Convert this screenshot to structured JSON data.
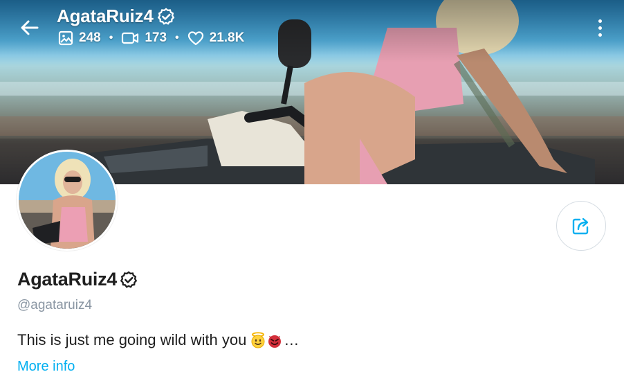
{
  "header": {
    "display_name": "AgataRuiz4",
    "stats": {
      "photos": "248",
      "videos": "173",
      "likes": "21.8K"
    }
  },
  "profile": {
    "display_name": "AgataRuiz4",
    "handle": "@agataruiz4",
    "bio": "This is just me going wild with you",
    "bio_suffix": "…",
    "more_info_label": "More info"
  },
  "icons": {
    "back": "arrow-left-icon",
    "verified": "verified-badge-icon",
    "photos": "image-icon",
    "videos": "video-camera-icon",
    "likes": "heart-outline-icon",
    "more": "more-vertical-icon",
    "share": "share-icon",
    "emoji_1": "smiling-face-with-halo",
    "emoji_2": "smiling-face-with-horns"
  },
  "colors": {
    "accent": "#00aff0",
    "text_primary": "#1f1f1f",
    "text_secondary": "#8a96a3",
    "border": "#d6dde3"
  }
}
